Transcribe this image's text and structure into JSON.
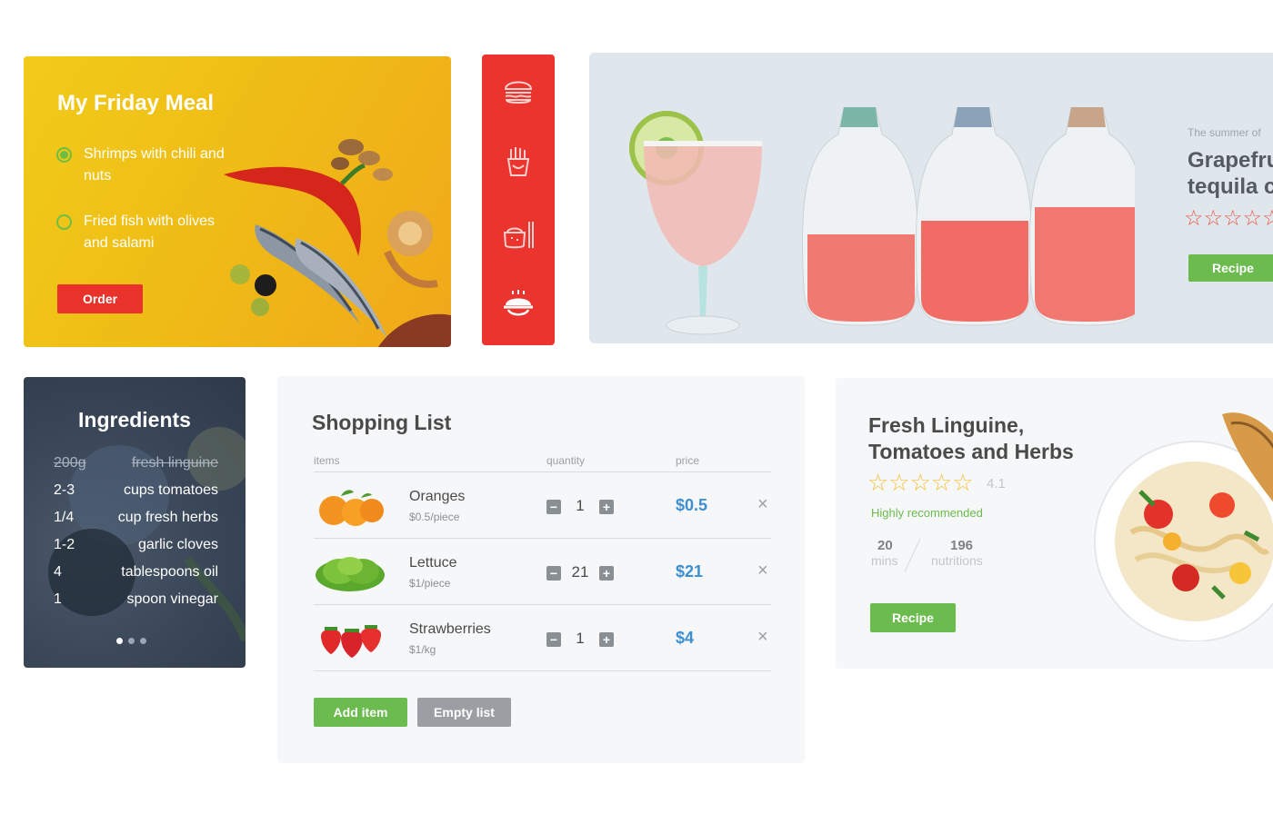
{
  "meal_card": {
    "title": "My Friday Meal",
    "items": [
      {
        "label": "Shrimps  with chili and nuts",
        "checked": true
      },
      {
        "label": "Fried fish with olives and salami",
        "checked": false
      }
    ],
    "order_label": "Order",
    "bg_color": "#efbd16"
  },
  "icon_rail": {
    "bg_color": "#ea342d",
    "icons": [
      "burger-icon",
      "fries-icon",
      "rice-bowl-chopsticks-icon",
      "serving-dish-icon"
    ]
  },
  "hero": {
    "subtitle": "The summer of",
    "title_line1": "Grapefru",
    "title_line2": "tequila c",
    "stars": "☆☆☆☆☆",
    "recipe_label": "Recipe"
  },
  "ingredients": {
    "title": "Ingredients",
    "rows": [
      {
        "qty": "200g",
        "name": "fresh linguine",
        "struck": true
      },
      {
        "qty": "2-3",
        "name": "cups tomatoes",
        "struck": false
      },
      {
        "qty": "1/4",
        "name": "cup fresh herbs",
        "struck": false
      },
      {
        "qty": "1-2",
        "name": "garlic cloves",
        "struck": false
      },
      {
        "qty": "4",
        "name": "tablespoons oil",
        "struck": false
      },
      {
        "qty": "1",
        "name": "spoon vinegar",
        "struck": false
      }
    ],
    "pages": 3,
    "active_page": 1
  },
  "shopping": {
    "title": "Shopping List",
    "columns": {
      "items": "items",
      "quantity": "quantity",
      "price": "price"
    },
    "rows": [
      {
        "name": "Oranges",
        "unit": "$0.5/piece",
        "quantity": "1",
        "price": "$0.5"
      },
      {
        "name": "Lettuce",
        "unit": "$1/piece",
        "quantity": "21",
        "price": "$21"
      },
      {
        "name": "Strawberries",
        "unit": "$1/kg",
        "quantity": "1",
        "price": "$4"
      }
    ],
    "minus": "−",
    "plus": "+",
    "remove": "×",
    "add_label": "Add item",
    "empty_label": "Empty list",
    "price_color": "#3d8fcf"
  },
  "linguine": {
    "title": "Fresh Linguine, Tomatoes and Herbs",
    "stars": "☆☆☆☆☆",
    "rating": "4.1",
    "recommendation": "Highly recommended",
    "time_value": "20",
    "time_label": "mins",
    "nutrition_value": "196",
    "nutrition_label": "nutritions",
    "recipe_label": "Recipe"
  },
  "colors": {
    "accent_green": "#6cbb4f",
    "accent_red": "#ea342d"
  }
}
